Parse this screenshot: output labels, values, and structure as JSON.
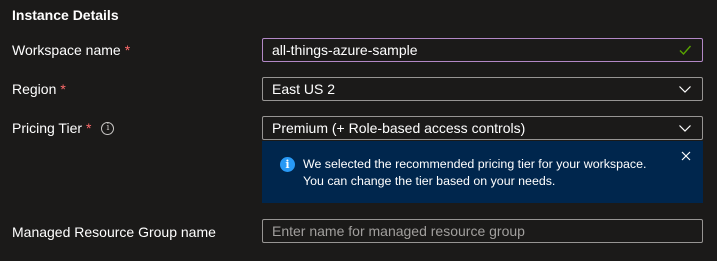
{
  "section": {
    "title": "Instance Details"
  },
  "fields": {
    "workspace": {
      "label": "Workspace name",
      "required_mark": "*",
      "value": "all-things-azure-sample"
    },
    "region": {
      "label": "Region",
      "required_mark": "*",
      "value": "East US 2"
    },
    "pricing": {
      "label": "Pricing Tier",
      "required_mark": "*",
      "info_glyph": "i",
      "value": "Premium (+ Role-based access controls)"
    },
    "resource_group": {
      "label": "Managed Resource Group name",
      "placeholder": "Enter name for managed resource group"
    }
  },
  "banner": {
    "text": "We selected the recommended pricing tier for your workspace. You can change the tier based on your needs.",
    "icon_glyph": "i"
  },
  "colors": {
    "background": "#1b1a19",
    "required": "#ff6b6b",
    "valid_border": "#b388c6",
    "check": "#57a300",
    "banner_bg": "#00264d",
    "info_blue": "#2899f5"
  },
  "icons": {
    "check": "checkmark-icon",
    "chevron": "chevron-down-icon",
    "info": "info-icon",
    "close": "close-icon"
  }
}
